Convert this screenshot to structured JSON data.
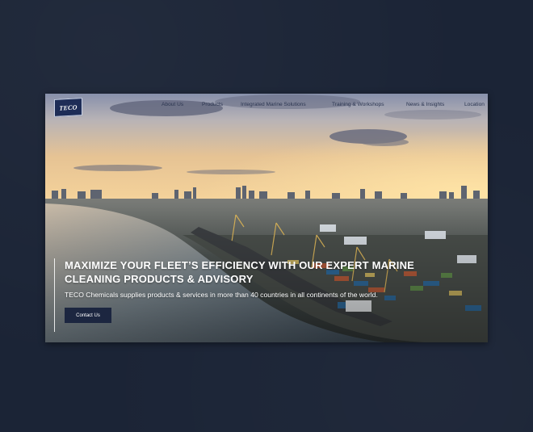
{
  "brand": {
    "logo_text": "TECO"
  },
  "nav": {
    "items": [
      {
        "label": "About Us"
      },
      {
        "label": "Products"
      },
      {
        "label": "Integrated Marine Solutions"
      },
      {
        "label": "Training & Workshops"
      },
      {
        "label": "News & Insights"
      },
      {
        "label": "Location"
      }
    ]
  },
  "hero": {
    "title": "MAXIMIZE YOUR FLEET’S EFFICIENCY WITH OUR EXPERT MARINE CLEANING PRODUCTS & ADVISORY",
    "subtitle": "TECO Chemicals supplies products & services in more than 40 countries in all continents of the world.",
    "cta_label": "Contact Us"
  },
  "colors": {
    "page_background": "#1b2436",
    "navy": "#1c2640",
    "nav_text": "#2b3550",
    "sky_top": "#8d96b2",
    "sky_glow": "#f3c98c"
  }
}
